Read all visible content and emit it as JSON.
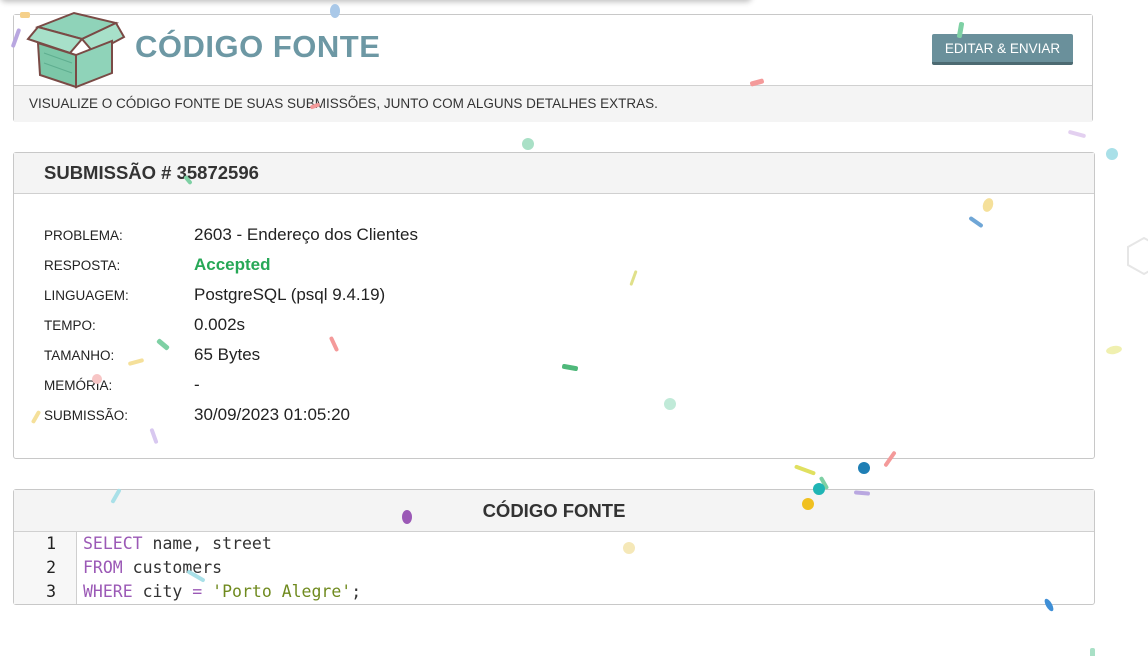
{
  "header": {
    "title": "CÓDIGO FONTE",
    "edit_button": "EDITAR & ENVIAR",
    "subtitle": "VISUALIZE O CÓDIGO FONTE DE SUAS SUBMISSÕES, JUNTO COM ALGUNS DETALHES EXTRAS."
  },
  "submission": {
    "heading": "SUBMISSÃO # 35872596",
    "fields": [
      {
        "label": "PROBLEMA:",
        "value": "2603 - Endereço dos Clientes"
      },
      {
        "label": "RESPOSTA:",
        "value": "Accepted"
      },
      {
        "label": "LINGUAGEM:",
        "value": "PostgreSQL (psql 9.4.19)"
      },
      {
        "label": "TEMPO:",
        "value": "0.002s"
      },
      {
        "label": "TAMANHO:",
        "value": "65 Bytes"
      },
      {
        "label": "MEMÓRIA:",
        "value": "-"
      },
      {
        "label": "SUBMISSÃO:",
        "value": "30/09/2023 01:05:20"
      }
    ]
  },
  "code": {
    "heading": "CÓDIGO FONTE",
    "lines": [
      {
        "number": "1",
        "tokens": [
          {
            "t": "SELECT",
            "k": "kw"
          },
          {
            "t": " name, street",
            "k": ""
          }
        ]
      },
      {
        "number": "2",
        "tokens": [
          {
            "t": "FROM",
            "k": "kw"
          },
          {
            "t": " customers",
            "k": ""
          }
        ]
      },
      {
        "number": "3",
        "tokens": [
          {
            "t": "WHERE",
            "k": "kw"
          },
          {
            "t": " city ",
            "k": ""
          },
          {
            "t": "=",
            "k": "op"
          },
          {
            "t": " ",
            "k": ""
          },
          {
            "t": "'Porto Alegre'",
            "k": "str"
          },
          {
            "t": ";",
            "k": ""
          }
        ]
      }
    ]
  },
  "colors": {
    "title": "#6d98a4",
    "button": "#6a909b",
    "accepted": "#27a857",
    "keyword": "#9b59b6",
    "string": "#6f8a1e"
  },
  "icons": {
    "logo": "open-box-icon"
  }
}
